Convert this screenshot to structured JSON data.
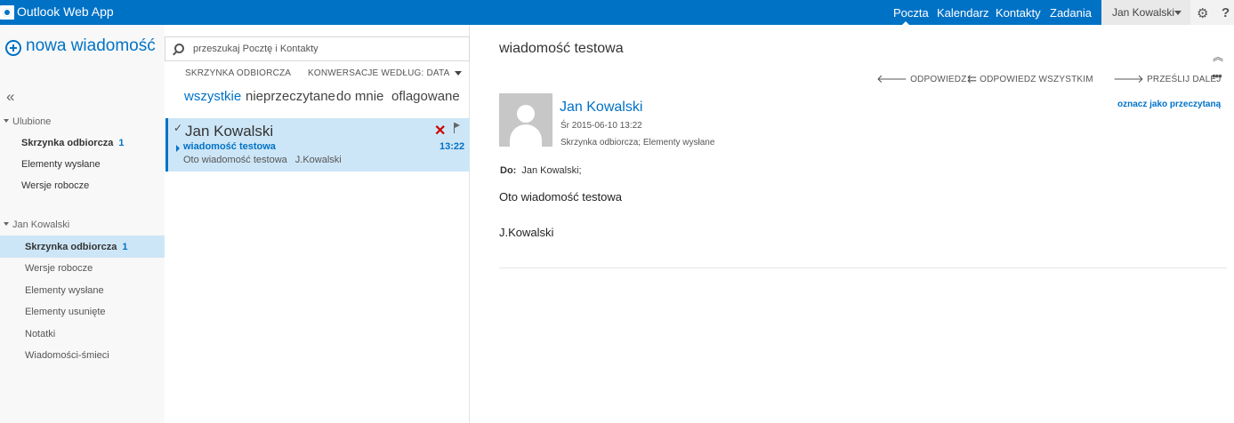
{
  "app": {
    "title": "Outlook Web App",
    "logo_icon": "outlook-logo-icon",
    "accent_color": "#0072c6"
  },
  "nav": {
    "links": [
      "Poczta",
      "Kalendarz",
      "Kontakty",
      "Zadania"
    ],
    "active": "Poczta",
    "user_name": "Jan Kowalski"
  },
  "sidebar": {
    "new_message": "nowa wiadomość",
    "favorites_header": "Ulubione",
    "favorites": [
      {
        "label": "Skrzynka odbiorcza",
        "count": "1"
      },
      {
        "label": "Elementy wysłane"
      },
      {
        "label": "Wersje robocze"
      }
    ],
    "account_header": "Jan Kowalski",
    "account_folders": [
      {
        "label": "Skrzynka odbiorcza",
        "count": "1"
      },
      {
        "label": "Wersje robocze"
      },
      {
        "label": "Elementy wysłane"
      },
      {
        "label": "Elementy usunięte"
      },
      {
        "label": "Notatki"
      },
      {
        "label": "Wiadomości-śmieci"
      }
    ]
  },
  "list": {
    "search_placeholder": "przeszukaj Pocztę i Kontakty",
    "folder_label": "SKRZYNKA ODBIORCZA",
    "sort_label": "KONWERSACJE WEDŁUG: DATA",
    "filters": [
      "wszystkie",
      "nieprzeczytane",
      "do mnie",
      "oflagowane"
    ],
    "active_filter": "wszystkie",
    "messages": [
      {
        "sender": "Jan Kowalski",
        "subject": "wiadomość testowa",
        "time": "13:22",
        "preview": "Oto wiadomość testowa",
        "preview_signature": "J.Kowalski"
      }
    ]
  },
  "reading": {
    "title": "wiadomość testowa",
    "actions": [
      "ODPOWIEDZ",
      "ODPOWIEDZ WSZYSTKIM",
      "PRZEŚLIJ DALEJ"
    ],
    "sender": "Jan Kowalski",
    "date": "Śr 2015-06-10 13:22",
    "folder_info": "Skrzynka odbiorcza; Elementy wysłane",
    "mark_unread": "oznacz jako przeczytaną",
    "to_label": "Do:",
    "to_value": "Jan Kowalski;",
    "body": [
      "Oto wiadomość testowa",
      "J.Kowalski"
    ]
  }
}
